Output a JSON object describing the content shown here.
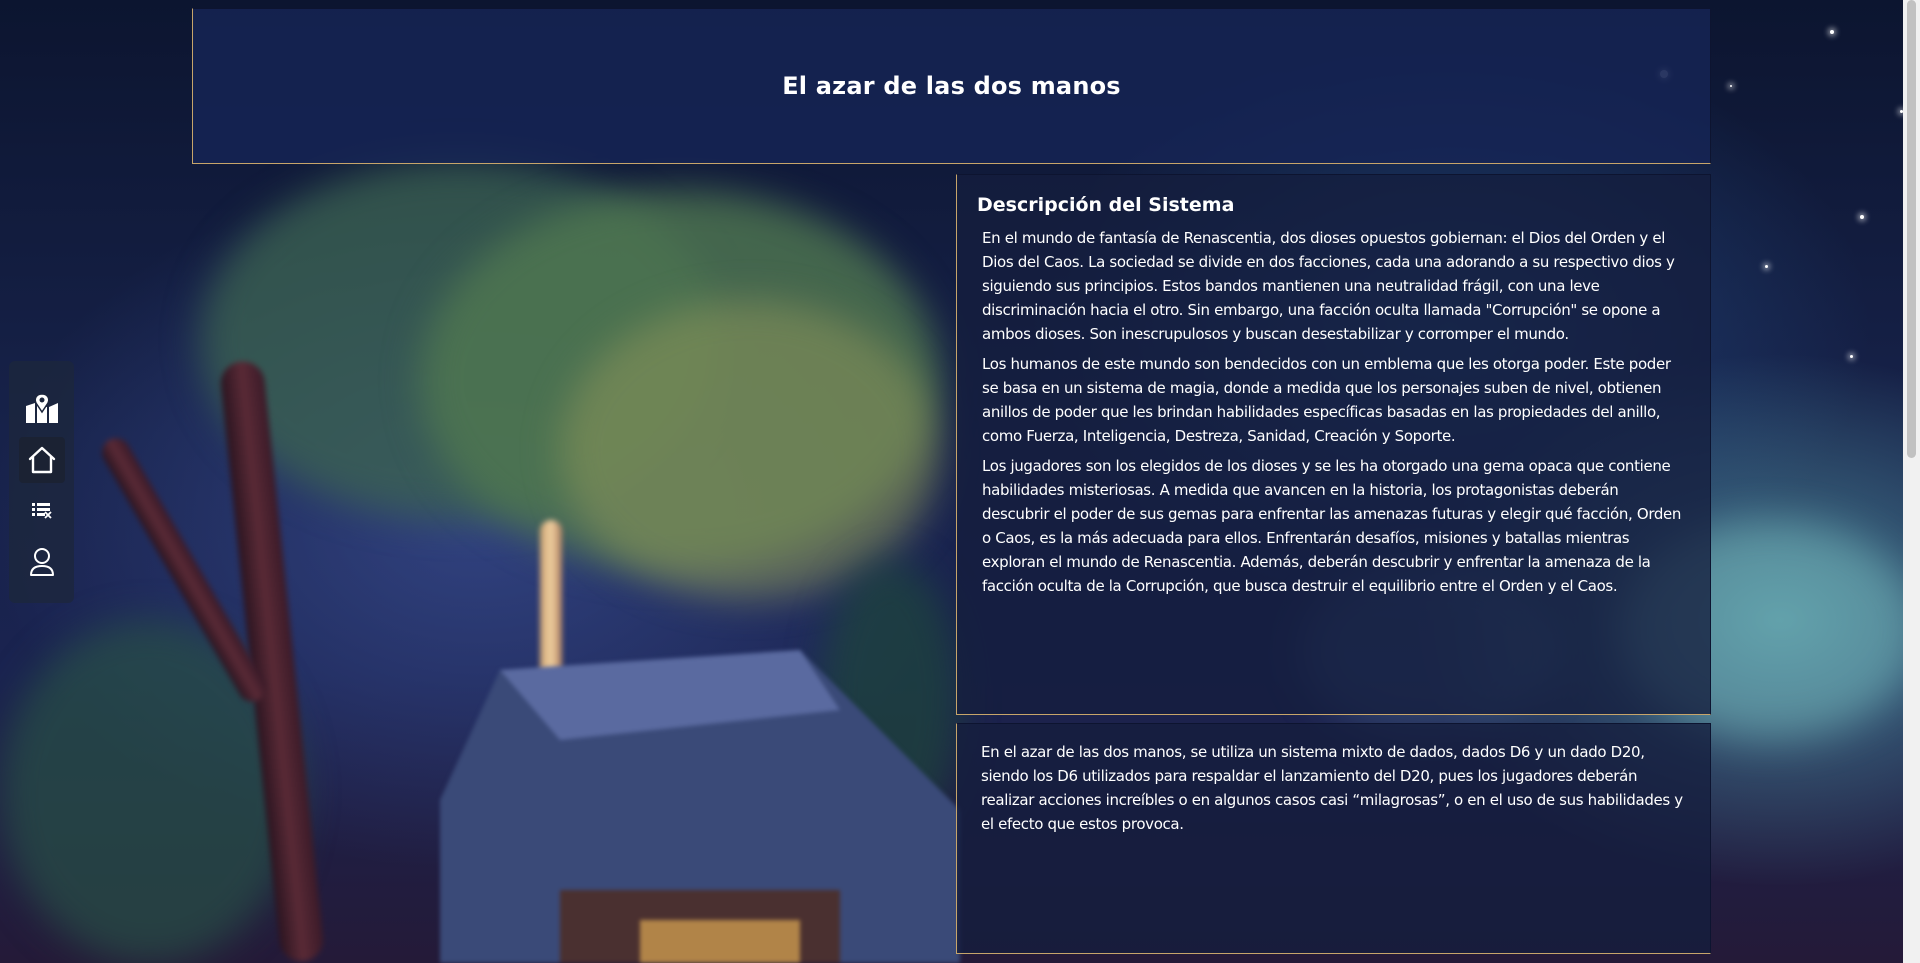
{
  "header": {
    "title": "El azar de las dos manos"
  },
  "sidenav": {
    "items": [
      {
        "icon": "map-icon",
        "active": false
      },
      {
        "icon": "home-icon",
        "active": true
      },
      {
        "icon": "list-icon",
        "active": false
      },
      {
        "icon": "user-icon",
        "active": false
      }
    ]
  },
  "description": {
    "title": "Descripción del Sistema",
    "paragraphs": [
      "En el mundo de fantasía de Renascentia, dos dioses opuestos gobiernan: el Dios del Orden y el Dios del Caos. La sociedad se divide en dos facciones, cada una adorando a su respectivo dios y siguiendo sus principios. Estos bandos mantienen una neutralidad frágil, con una leve discriminación hacia el otro. Sin embargo, una facción oculta llamada \"Corrupción\" se opone a ambos dioses. Son inescrupulosos y buscan desestabilizar y corromper el mundo.",
      "Los humanos de este mundo son bendecidos con un emblema que les otorga poder. Este poder se basa en un sistema de magia, donde a medida que los personajes suben de nivel, obtienen anillos de poder que les brindan habilidades específicas basadas en las propiedades del anillo, como Fuerza, Inteligencia, Destreza, Sanidad, Creación y Soporte.",
      "Los jugadores son los elegidos de los dioses y se les ha otorgado una gema opaca que contiene habilidades misteriosas. A medida que avancen en la historia, los protagonistas deberán descubrir el poder de sus gemas para enfrentar las amenazas futuras y elegir qué facción, Orden o Caos, es la más adecuada para ellos. Enfrentarán desafíos, misiones y batallas mientras exploran el mundo de Renascentia. Además, deberán descubrir y enfrentar la amenaza de la facción oculta de la Corrupción, que busca destruir el equilibrio entre el Orden y el Caos."
    ]
  },
  "dice": {
    "paragraph": "En el azar de las dos manos, se utiliza un sistema mixto de dados, dados D6 y un dado D20, siendo los D6 utilizados para respaldar el lanzamiento del D20, pues los jugadores deberán realizar acciones increíbles o en algunos casos casi “milagrosas”, o en el uso de sus habilidades y el efecto que estos provoca."
  },
  "colors": {
    "accent_border": "#c7a56a",
    "panel_bg": "#16244f",
    "scrollbar_track": "#f1f1f1",
    "scrollbar_thumb": "#c1c1c1"
  }
}
